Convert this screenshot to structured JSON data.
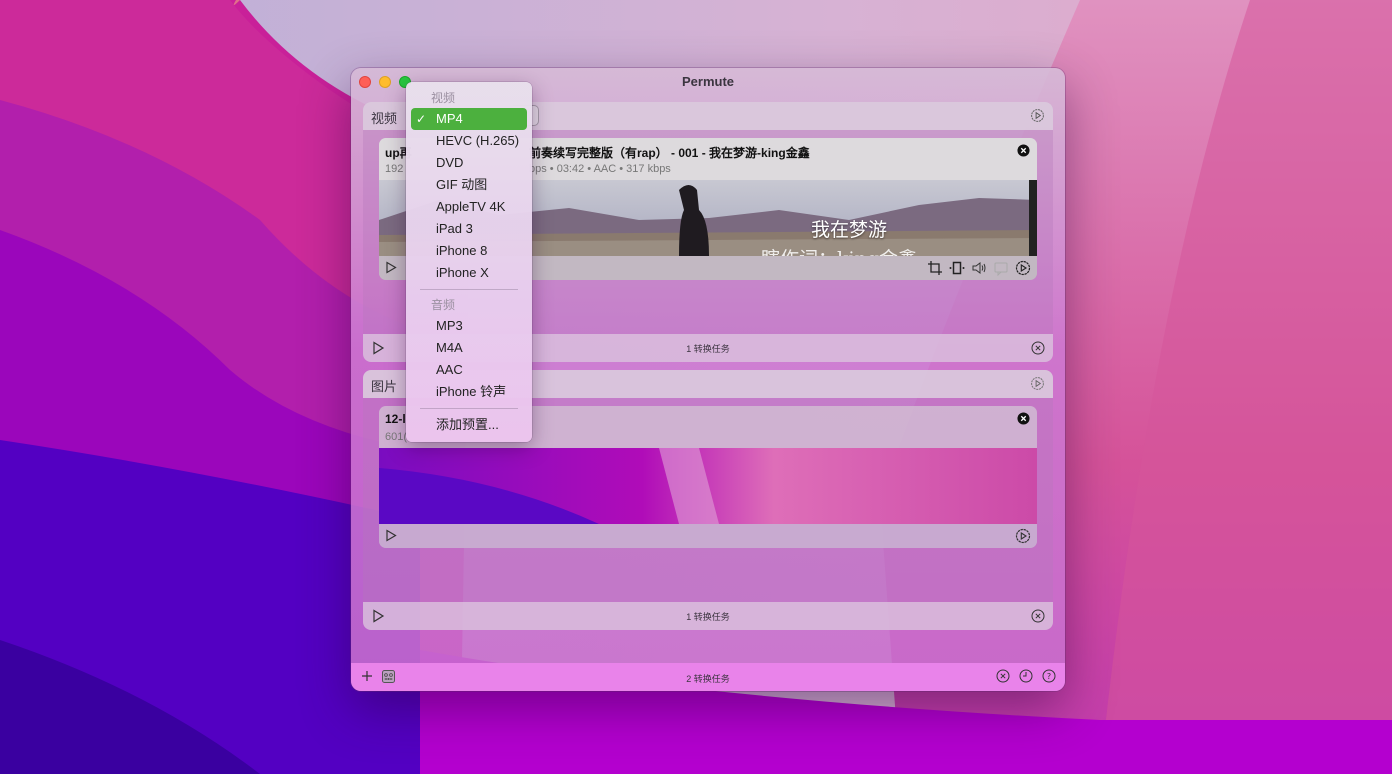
{
  "window": {
    "title": "Permute"
  },
  "sections": {
    "video": {
      "label": "视频",
      "item": {
        "title": "up再…前奏续写完整版（有rap） - 001 - 我在梦游-king金鑫",
        "title_left": "up再",
        "title_right": "前奏续写完整版（有rap） - 001 - 我在梦游-king金鑫",
        "meta_left": "192",
        "meta_right": "bps • 03:42 • AAC • 317 kbps",
        "lyric_line1": "我在梦游",
        "lyric_line2": "瞎作词：king金鑫"
      },
      "footer_text": "1 转换任务"
    },
    "image": {
      "label": "图片",
      "item": {
        "title": "12-l",
        "meta": "601("
      },
      "footer_text": "1 转换任务"
    }
  },
  "bottombar": {
    "status": "2 转换任务"
  },
  "menu": {
    "video_header": "视频",
    "video_items": [
      {
        "label": "MP4",
        "selected": true
      },
      {
        "label": "HEVC (H.265)"
      },
      {
        "label": "DVD"
      },
      {
        "label": "GIF 动图"
      },
      {
        "label": "AppleTV 4K"
      },
      {
        "label": "iPad 3"
      },
      {
        "label": "iPhone 8"
      },
      {
        "label": "iPhone X"
      }
    ],
    "audio_header": "音频",
    "audio_items": [
      {
        "label": "MP3"
      },
      {
        "label": "M4A"
      },
      {
        "label": "AAC"
      },
      {
        "label": "iPhone 铃声"
      }
    ],
    "add_preset": "添加预置...",
    "check_glyph": "✓"
  },
  "colors": {
    "selected_highlight": "#4cb03e",
    "bottombar": "#e983ea",
    "close_traffic": "#fe5f57",
    "minimize_traffic": "#febc2e",
    "zoom_traffic": "#28c840"
  }
}
